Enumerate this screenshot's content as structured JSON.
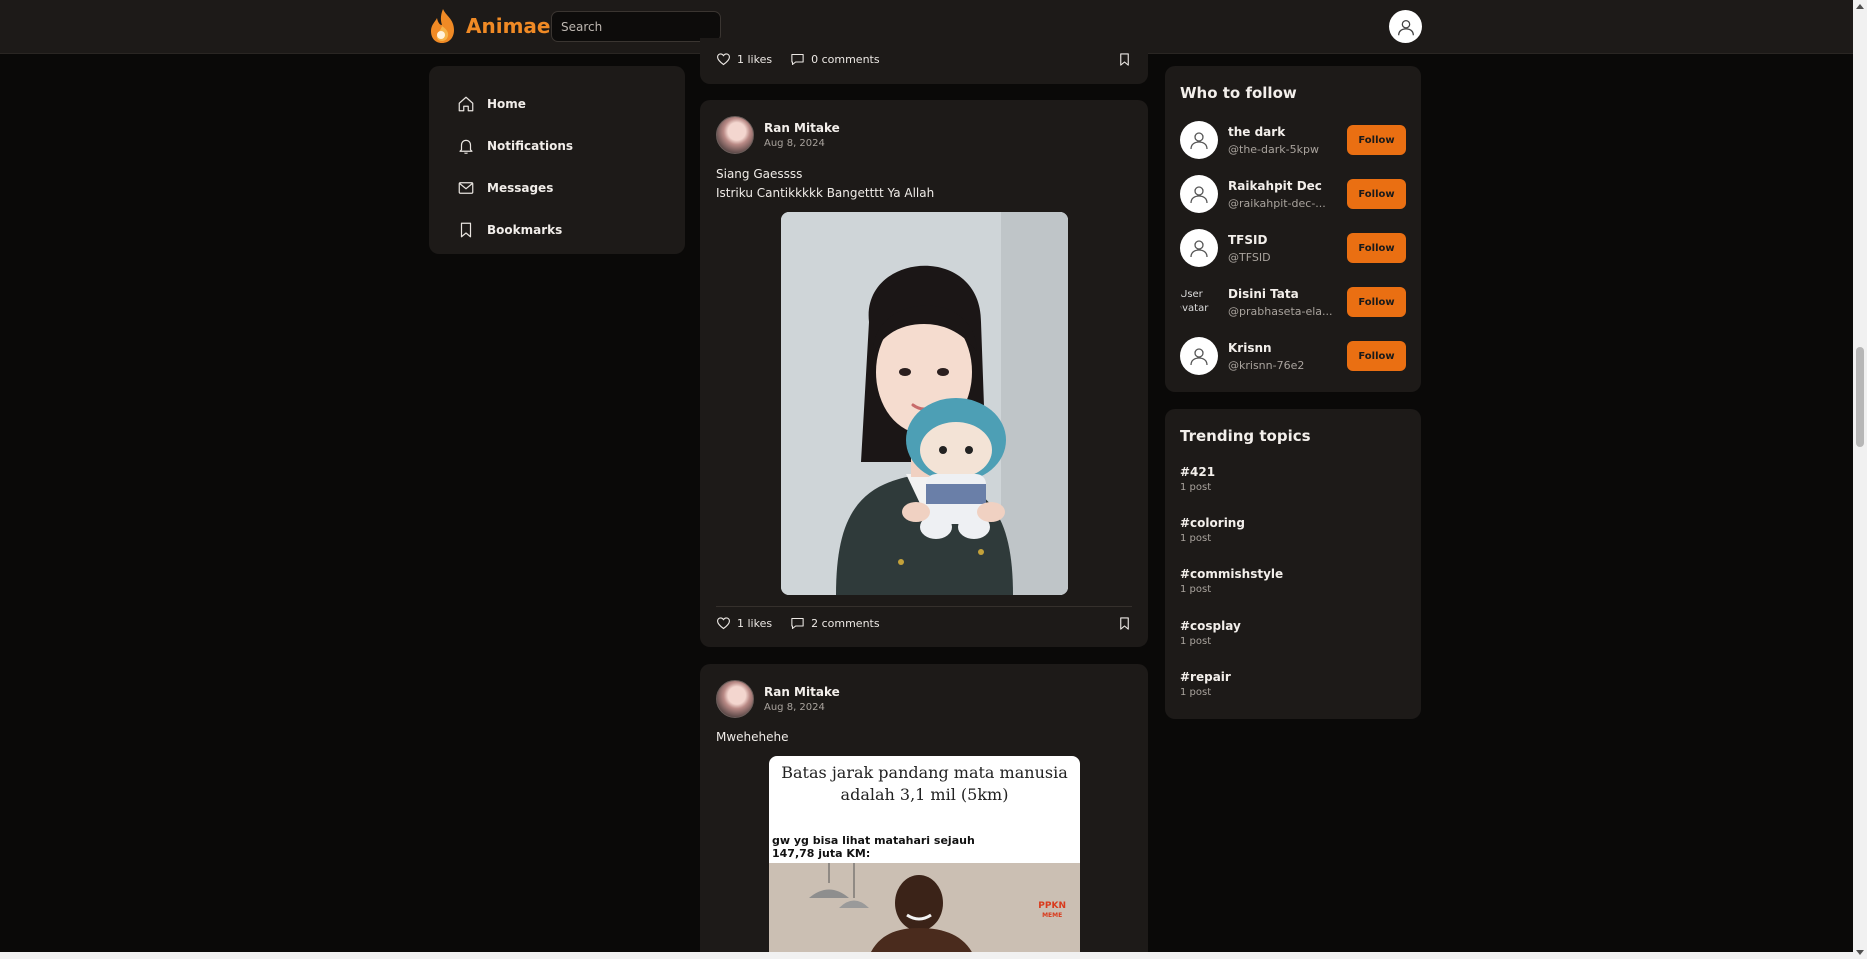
{
  "header": {
    "brand": "Animae",
    "search_placeholder": "Search"
  },
  "nav": {
    "items": [
      {
        "label": "Home",
        "icon": "home-icon"
      },
      {
        "label": "Notifications",
        "icon": "bell-icon"
      },
      {
        "label": "Messages",
        "icon": "mail-icon"
      },
      {
        "label": "Bookmarks",
        "icon": "bookmark-icon"
      }
    ]
  },
  "feed": {
    "top_card": {
      "likes": "1 likes",
      "comments": "0 comments"
    },
    "posts": [
      {
        "author": "Ran Mitake",
        "date": "Aug 8, 2024",
        "text_line1": "Siang Gaessss",
        "text_line2": "Istriku Cantikkkkk Bangetttt Ya Allah",
        "likes": "1 likes",
        "comments": "2 comments"
      },
      {
        "author": "Ran Mitake",
        "date": "Aug 8, 2024",
        "text_line1": "Mwehehehe",
        "meme_title": "Batas jarak pandang mata manusia adalah 3,1 mil (5km)",
        "meme_sub_line1": "gw yg bisa lihat matahari sejauh",
        "meme_sub_line2": "147,78 juta KM:",
        "meme_badge_line1": "PPKN",
        "meme_badge_line2": "MEME"
      }
    ]
  },
  "who_to_follow": {
    "title": "Who to follow",
    "follow_label": "Follow",
    "users": [
      {
        "name": "the dark",
        "handle": "@the-dark-5kpw"
      },
      {
        "name": "Raikahpit Dec",
        "handle": "@raikahpit-dec-..."
      },
      {
        "name": "TFSID",
        "handle": "@TFSID"
      },
      {
        "name": "Disini Tata",
        "handle": "@prabhaseta-ela...",
        "broken_alt_line1": "User",
        "broken_alt_line2": "avatar"
      },
      {
        "name": "Krisnn",
        "handle": "@krisnn-76e2"
      }
    ]
  },
  "trending": {
    "title": "Trending topics",
    "topics": [
      {
        "tag": "#421",
        "count": "1 post"
      },
      {
        "tag": "#coloring",
        "count": "1 post"
      },
      {
        "tag": "#commishstyle",
        "count": "1 post"
      },
      {
        "tag": "#cosplay",
        "count": "1 post"
      },
      {
        "tag": "#repair",
        "count": "1 post"
      }
    ]
  },
  "colors": {
    "accent": "#ea6f12",
    "brand": "#f08a25",
    "background": "#0a0908",
    "card": "#1d1a18"
  }
}
